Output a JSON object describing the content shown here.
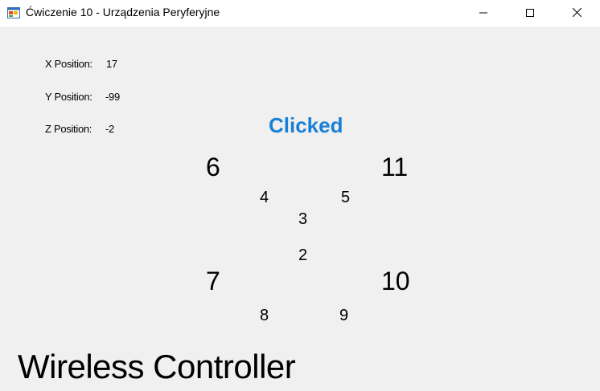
{
  "window": {
    "title": "Ćwiczenie 10 - Urządzenia Peryferyjne"
  },
  "positions": {
    "x_label": "X Position:",
    "x_value": "17",
    "y_label": "Y Position:",
    "y_value": "-99",
    "z_label": "Z Position:",
    "z_value": "-2"
  },
  "status": {
    "text": "Clicked",
    "color": "#1b7fd6"
  },
  "buttons": {
    "b2": "2",
    "b3": "3",
    "b4": "4",
    "b5": "5",
    "b6": "6",
    "b7": "7",
    "b8": "8",
    "b9": "9",
    "b10": "10",
    "b11": "11"
  },
  "footer": {
    "title": "Wireless Controller"
  },
  "icons": {
    "app": "app-window-icon",
    "minimize": "minimize-icon",
    "maximize": "maximize-icon",
    "close": "close-icon"
  }
}
